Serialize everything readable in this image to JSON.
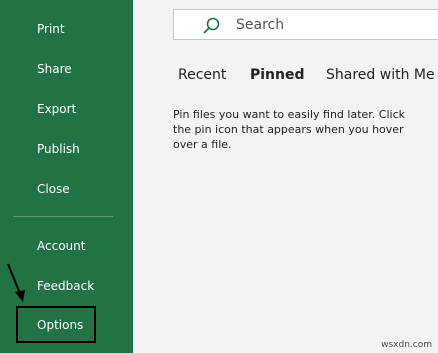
{
  "sidebar": {
    "items": [
      {
        "label": "Print"
      },
      {
        "label": "Share"
      },
      {
        "label": "Export"
      },
      {
        "label": "Publish"
      },
      {
        "label": "Close"
      },
      {
        "label": "Account"
      },
      {
        "label": "Feedback"
      },
      {
        "label": "Options"
      }
    ]
  },
  "search": {
    "placeholder": "Search",
    "icon": "search-icon"
  },
  "tabs": [
    {
      "label": "Recent"
    },
    {
      "label": "Pinned",
      "active": true
    },
    {
      "label": "Shared with Me"
    }
  ],
  "info_text": "Pin files you want to easily find later. Click the pin icon that appears when you hover over a file.",
  "watermark": "wsxdn.com",
  "colors": {
    "sidebar": "#217346",
    "background": "#f3f3f3",
    "annotation": "#000000"
  }
}
